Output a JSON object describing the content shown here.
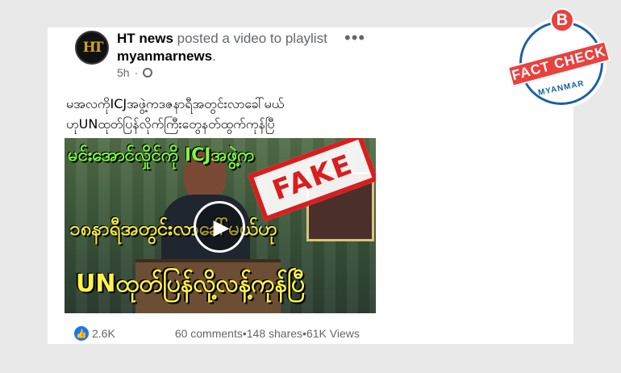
{
  "post": {
    "author": "HT news",
    "action_text": " posted a video to playlist",
    "playlist": "myanmarnews",
    "playlist_suffix": ".",
    "time": "5h",
    "more_label": "•••",
    "avatar_text": "HT",
    "text_line1": "မအလကိုICJအဖွဲ့ကဒဇနာရီအတွင်းလာခေါ်မယ်",
    "text_line2": "ဟုUNထုတ်ပြန်လိုက်ကြီးတွေနတ်ထွက်ကုန်ပြီ"
  },
  "video": {
    "caption_top": "မင်းအောင်လှိုင်ကို  ICJအဖွဲ့က",
    "caption_mid": "၁၈နာရီအတွင်းလာခေါ်မယ်ဟု",
    "caption_bottom": "UNထုတ်ပြန်လို့လန့်ကုန်ပြီ",
    "stamp": "FAKE",
    "play_icon": "play-icon"
  },
  "stats": {
    "likes": "2.6K",
    "comments": "60 comments",
    "shares": "148 shares",
    "views": "61K Views",
    "separator": " • "
  },
  "badge": {
    "letter": "B",
    "band": "FACT CHECK",
    "bottom": "MYANMAR"
  },
  "colors": {
    "background": "#e9e9e9",
    "stamp_red": "#d81e1e",
    "badge_red": "#e8423f",
    "badge_blue": "#1a5fa8",
    "like_blue": "#1877f2"
  }
}
